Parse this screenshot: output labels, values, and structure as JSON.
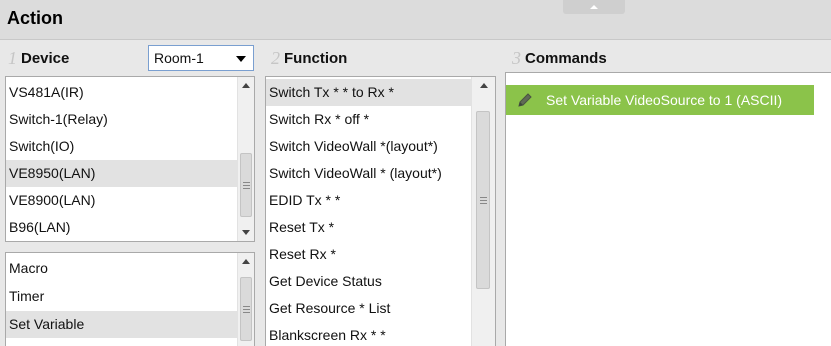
{
  "panel": {
    "title": "Action"
  },
  "device": {
    "number": "1",
    "header": "Device",
    "room_select": "Room-1",
    "items": [
      "VS481A(IR)",
      "Switch-1(Relay)",
      "Switch(IO)",
      "VE8950(LAN)",
      "VE8900(LAN)",
      "B96(LAN)"
    ],
    "selected_index": 3,
    "extra_items": [
      "Macro",
      "Timer",
      "Set Variable"
    ],
    "extra_selected_index": 2
  },
  "function": {
    "number": "2",
    "header": "Function",
    "items": [
      "Switch Tx * * to Rx *",
      "Switch Rx * off *",
      "Switch VideoWall *(layout*)",
      "Switch VideoWall * (layout*)",
      "EDID Tx * *",
      "Reset Tx *",
      "Reset Rx *",
      "Get Device Status",
      "Get Resource * List",
      "Blankscreen Rx * *"
    ],
    "selected_index": 0
  },
  "commands": {
    "number": "3",
    "header": "Commands",
    "items": [
      {
        "icon": "pencil-icon",
        "label": "Set Variable VideoSource to 1 (ASCII)"
      }
    ],
    "highlight_color": "#8bc34a"
  }
}
